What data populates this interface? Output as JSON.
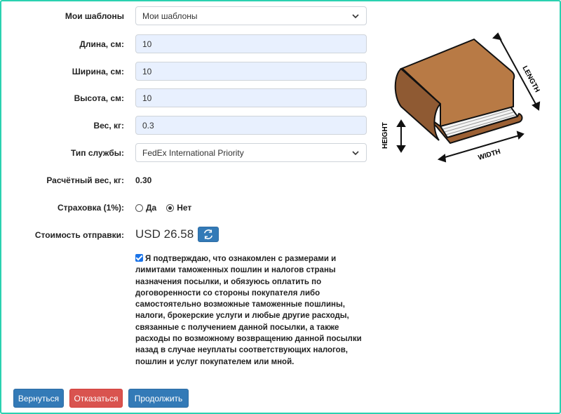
{
  "templates": {
    "label": "Мои шаблоны",
    "value": "Мои шаблоны"
  },
  "length": {
    "label": "Длина, см:",
    "value": "10"
  },
  "width": {
    "label": "Ширина, см:",
    "value": "10"
  },
  "height": {
    "label": "Высота, см:",
    "value": "10"
  },
  "weight": {
    "label": "Вес, кг:",
    "value": "0.3"
  },
  "service": {
    "label": "Тип службы:",
    "value": "FedEx International Priority"
  },
  "calc_weight": {
    "label": "Расчётный вес, кг:",
    "value": "0.30"
  },
  "insurance": {
    "label": "Страховка (1%):",
    "yes": "Да",
    "no": "Нет",
    "selected": "no"
  },
  "shipping_cost": {
    "label": "Стоимость отправки:",
    "value": "USD 26.58"
  },
  "confirmation": {
    "checked": true,
    "text": "Я подтверждаю, что ознакомлен с размерами и лимитами таможенных пошлин и налогов страны назначения посылки, и обязуюсь оплатить по договоренности со стороны покупателя либо самостоятельно возможные таможенные пошлины, налоги, брокерские услуги и любые другие расходы, связанные с получением данной посылки, а также расходы по возможному возвращению данной посылки назад в случае неуплаты соответствующих налогов, пошлин и услуг покупателем или мной."
  },
  "diagram": {
    "length_label": "LENGTH",
    "width_label": "WIDTH",
    "height_label": "HEIGHT"
  },
  "buttons": {
    "back": "Вернуться",
    "cancel": "Отказаться",
    "next": "Продолжить"
  },
  "colors": {
    "primary": "#337ab7",
    "danger": "#d9534f",
    "input_bg": "#e8f0fe",
    "frame": "#2ad1b0",
    "book_cover": "#b87a45"
  }
}
